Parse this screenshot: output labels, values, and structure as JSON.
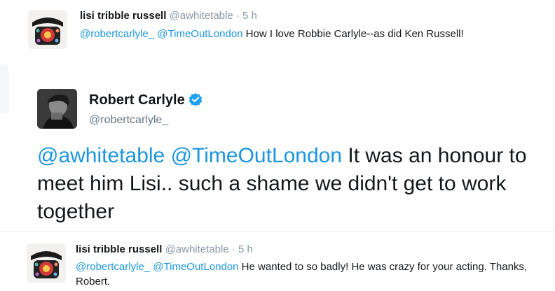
{
  "tweet1": {
    "name": "lisi tribble russell",
    "handle": "@awhitetable",
    "dot": "·",
    "time": "5 h",
    "mention1": "@robertcarlyle_",
    "mention2": "@TimeOutLondon",
    "text": " How I love Robbie Carlyle--as did Ken Russell!"
  },
  "tweet2": {
    "name": "Robert Carlyle",
    "handle": "@robertcarlyle_",
    "mention1": "@awhitetable",
    "mention2": "@TimeOutLondon",
    "text": " It was an honour to meet him Lisi.. such a shame we didn't get to work together"
  },
  "tweet3": {
    "name": "lisi tribble russell",
    "handle": "@awhitetable",
    "dot": "·",
    "time": "5 h",
    "mention1": "@robertcarlyle_",
    "mention2": "@TimeOutLondon",
    "text": " He wanted to so badly! He was crazy for your acting. Thanks, Robert."
  },
  "colors": {
    "link": "#1b95e0",
    "muted": "#8899a6",
    "verified": "#1da1f2"
  },
  "icons": {
    "avatar1": "rotary-phone-avatar",
    "avatar2": "portrait-avatar",
    "verified": "verified-badge-icon"
  }
}
